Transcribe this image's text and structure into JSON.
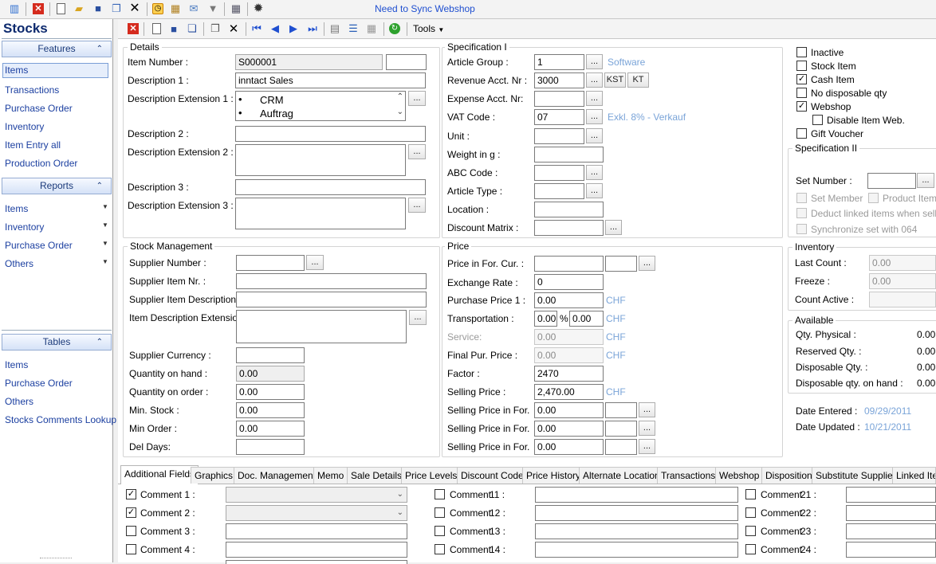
{
  "toolbar": {
    "icons": [
      "chart-icon",
      "close-red-icon",
      "new-doc-icon",
      "open-folder-icon",
      "save-icon",
      "copy-icon",
      "delete-x-icon",
      "clock-icon",
      "email-icon",
      "filter-icon",
      "grid-icon",
      "settings-icon"
    ],
    "sync_label": "Need to Sync Webshop"
  },
  "nav": {
    "title": "Stocks",
    "features_label": "Features",
    "features": [
      "Items",
      "Transactions",
      "Purchase Order",
      "Inventory",
      "Item Entry all",
      "Production Order"
    ],
    "reports_label": "Reports",
    "reports": [
      "Items",
      "Inventory",
      "Purchase Order",
      "Others"
    ],
    "tables_label": "Tables",
    "tables": [
      "Items",
      "Purchase Order",
      "Others",
      "Stocks Comments Lookup"
    ]
  },
  "subtoolbar": {
    "tools_label": "Tools"
  },
  "details": {
    "legend": "Details",
    "item_number_label": "Item Number :",
    "item_number": "S000001",
    "description1_label": "Description 1 :",
    "description1": "inntact Sales",
    "desc_ext1_label": "Description Extension 1 :",
    "desc_ext1_lines": [
      "CRM",
      "Auftrag"
    ],
    "description2_label": "Description 2 :",
    "desc_ext2_label": "Description Extension 2 :",
    "description3_label": "Description 3 :",
    "desc_ext3_label": "Description Extension 3 :"
  },
  "spec1": {
    "legend": "Specification I",
    "article_group_label": "Article Group :",
    "article_group": "1",
    "article_group_hint": "Software",
    "revenue_label": "Revenue Acct. Nr :",
    "revenue": "3000",
    "kst_label": "KST",
    "kt_label": "KT",
    "expense_label": "Expense Acct. Nr:",
    "vat_label": "VAT Code :",
    "vat": "07",
    "vat_hint": "Exkl. 8% - Verkauf",
    "unit_label": "Unit :",
    "weight_label": "Weight in g :",
    "abc_label": "ABC Code :",
    "article_type_label": "Article Type :",
    "location_label": "Location :",
    "discount_matrix_label": "Discount Matrix :"
  },
  "flags": {
    "inactive": "Inactive",
    "stock_item": "Stock Item",
    "cash_item": "Cash Item",
    "no_disposable": "No disposable qty",
    "webshop": "Webshop",
    "disable_web": "Disable Item Web.",
    "gift_voucher": "Gift Voucher"
  },
  "spec2": {
    "legend": "Specification II",
    "set_number_label": "Set Number :",
    "set_member": "Set Member",
    "product_item": "Product Item",
    "deduct_linked": "Deduct linked items when selling",
    "sync_set": "Synchronize set with 064"
  },
  "stock": {
    "legend": "Stock Management",
    "supplier_number_label": "Supplier Number :",
    "supplier_item_nr_label": "Supplier Item Nr. :",
    "supplier_item_desc_label": "Supplier Item Description :",
    "item_desc_ext_label": "Item Description Extension",
    "supplier_currency_label": "Supplier Currency :",
    "qty_hand_label": "Quantity on hand :",
    "qty_hand": "0.00",
    "qty_order_label": "Quantity on order :",
    "qty_order": "0.00",
    "min_stock_label": "Min. Stock :",
    "min_stock": "0.00",
    "min_order_label": "Min Order :",
    "min_order": "0.00",
    "del_days_label": "Del Days:"
  },
  "price": {
    "legend": "Price",
    "price_for_cur_label": "Price in For. Cur. :",
    "exchange_rate_label": "Exchange Rate :",
    "exchange_rate": "0",
    "purchase_price_label": "Purchase Price 1 :",
    "purchase_price": "0.00",
    "transportation_label": "Transportation :",
    "transport_a": "0.00",
    "percent": "%",
    "transport_b": "0.00",
    "service_label": "Service:",
    "service": "0.00",
    "final_label": "Final Pur. Price :",
    "final": "0.00",
    "factor_label": "Factor :",
    "factor": "2470",
    "selling_label": "Selling Price :",
    "selling": "2,470.00",
    "currency": "CHF",
    "selling_for_label": "Selling Price in For.",
    "selling_for_1": "0.00",
    "selling_for_2": "0.00",
    "selling_for_3": "0.00"
  },
  "inventory": {
    "legend": "Inventory",
    "last_count_label": "Last Count :",
    "last_count": "0.00",
    "freeze_label": "Freeze :",
    "freeze": "0.00",
    "count_active_label": "Count Active :"
  },
  "available": {
    "legend": "Available",
    "physical_label": "Qty. Physical :",
    "physical": "0.00",
    "reserved_label": "Reserved Qty. :",
    "reserved": "0.00",
    "disposable_label": "Disposable Qty. :",
    "disposable": "0.00",
    "disposable_hand_label": "Disposable qty. on hand :",
    "disposable_hand": "0.00"
  },
  "dates": {
    "entered_label": "Date Entered :",
    "entered": "09/29/2011",
    "updated_label": "Date Updated :",
    "updated": "10/21/2011"
  },
  "tabs": [
    "Additional Fields",
    "Graphics",
    "Doc. Management",
    "Memo",
    "Sale Details",
    "Price Levels",
    "Discount Code",
    "Price History",
    "Alternate Location",
    "Transactions",
    "Webshop",
    "Disposition",
    "Substitute Supplier",
    "Linked Iter"
  ],
  "comments": {
    "col1": [
      "Comment 1 :",
      "Comment 2 :",
      "Comment 3 :",
      "Comment 4 :"
    ],
    "col2": [
      "Comment",
      "Comment",
      "Comment",
      "Comment"
    ],
    "col2_nums": [
      "11 :",
      "12 :",
      "13 :",
      "14 :"
    ],
    "col3": [
      "Comment",
      "Comment",
      "Comment",
      "Comment"
    ],
    "col3_nums": [
      "21 :",
      "22 :",
      "23 :",
      "24 :"
    ]
  }
}
